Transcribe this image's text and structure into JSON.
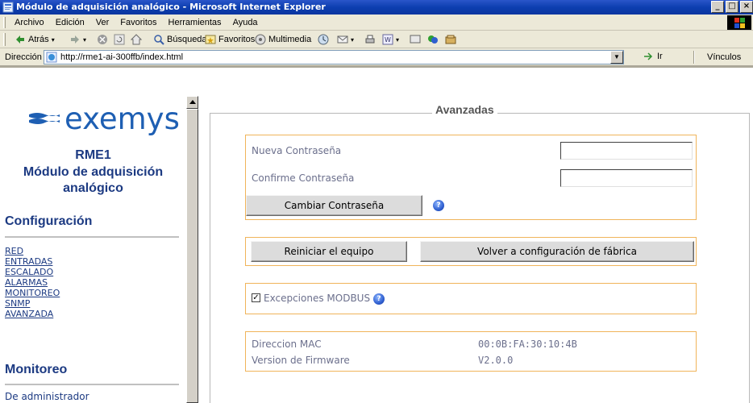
{
  "window": {
    "title": "Módulo de adquisición analógico - Microsoft Internet Explorer",
    "minimize": "_",
    "restore": "□",
    "close": "×"
  },
  "menu": {
    "items": [
      "Archivo",
      "Edición",
      "Ver",
      "Favoritos",
      "Herramientas",
      "Ayuda"
    ]
  },
  "toolbar": {
    "back": "Atrás",
    "search": "Búsqueda",
    "favorites": "Favoritos",
    "multimedia": "Multimedia"
  },
  "address": {
    "label": "Dirección",
    "url": "http://rme1-ai-300ffb/index.html",
    "go": "Ir",
    "links": "Vínculos"
  },
  "sidebar": {
    "logo": "exemys",
    "device_name": "RME1",
    "device_desc_line1": "Módulo de adquisición",
    "device_desc_line2": "analógico",
    "config_heading": "Configuración",
    "nav": [
      "RED",
      "ENTRADAS",
      "ESCALADO",
      "ALARMAS",
      "MONITOREO",
      "SNMP",
      "AVANZADA"
    ],
    "monitor_heading": "Monitoreo",
    "admin_link": "De administrador"
  },
  "main": {
    "legend": "Avanzadas",
    "new_password_label": "Nueva Contraseña",
    "new_password_value": "",
    "confirm_password_label": "Confirme Contraseña",
    "confirm_password_value": "",
    "change_password_button": "Cambiar Contraseña",
    "reboot_button": "Reiniciar el equipo",
    "factory_button": "Volver a configuración de fábrica",
    "modbus_label": "Excepciones MODBUS",
    "modbus_checked": true,
    "mac_label": "Direccion MAC",
    "mac_value": "00:0B:FA:30:10:4B",
    "firmware_label": "Version de Firmware",
    "firmware_value": "V2.0.0",
    "help_glyph": "?"
  },
  "colors": {
    "title_bar": "#0d3fb0",
    "chrome": "#ece9d8",
    "brand_blue": "#1e5fb3",
    "heading_blue": "#1c3a82",
    "box_border": "#f0b45a",
    "label_text": "#6b6f8c"
  }
}
